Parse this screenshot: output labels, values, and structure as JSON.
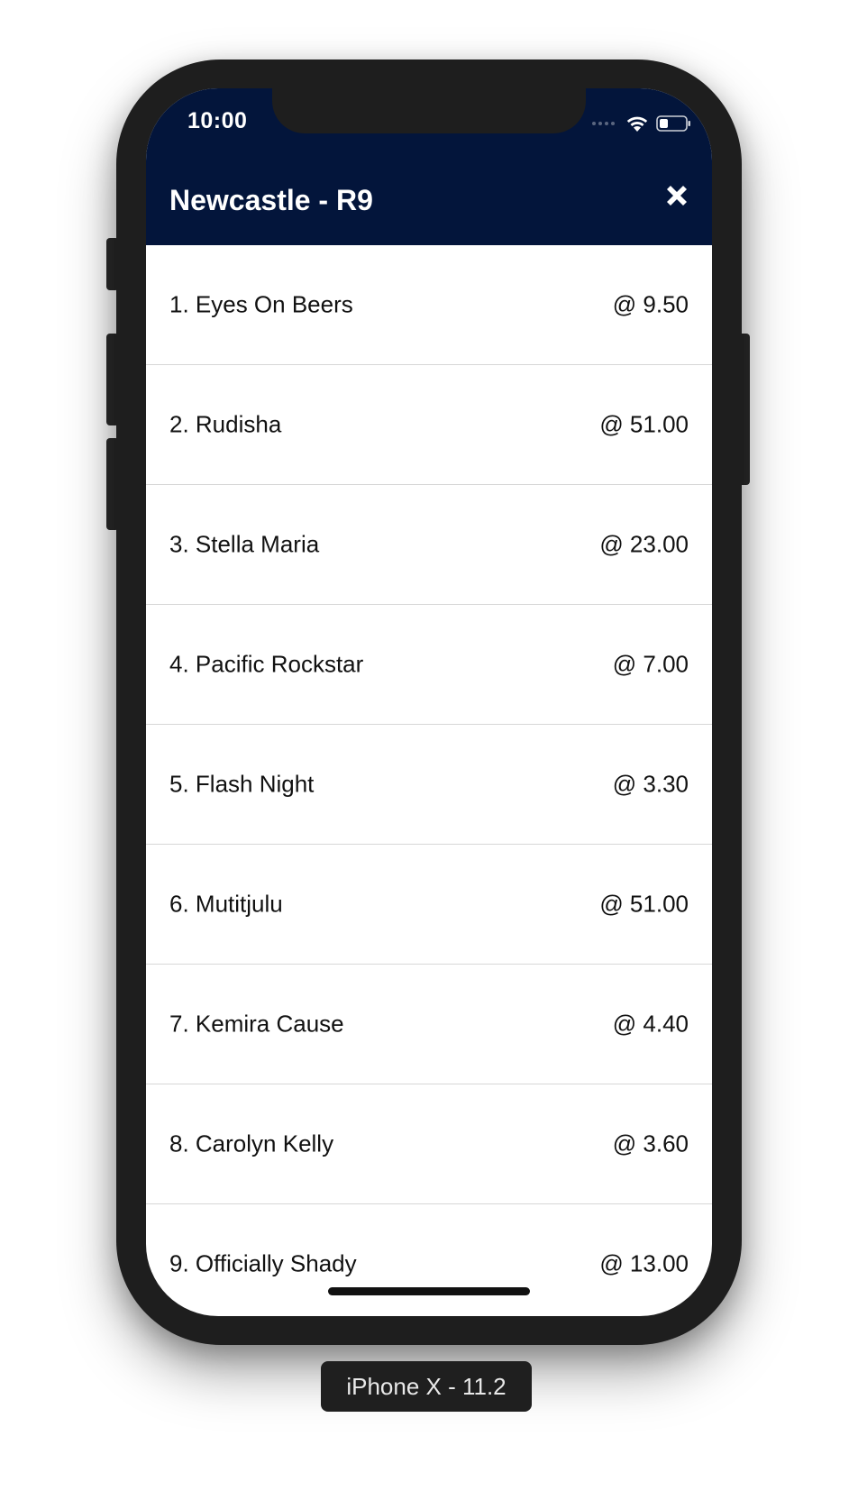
{
  "status_bar": {
    "time": "10:00"
  },
  "header": {
    "title": "Newcastle - R9",
    "close_icon": "close-icon",
    "background_color": "#03153b"
  },
  "runners": [
    {
      "name": "1. Eyes On Beers",
      "odds": "@ 9.50"
    },
    {
      "name": "2. Rudisha",
      "odds": "@ 51.00"
    },
    {
      "name": "3. Stella Maria",
      "odds": "@ 23.00"
    },
    {
      "name": "4. Pacific Rockstar",
      "odds": "@ 7.00"
    },
    {
      "name": "5. Flash Night",
      "odds": "@ 3.30"
    },
    {
      "name": "6. Mutitjulu",
      "odds": "@ 51.00"
    },
    {
      "name": "7. Kemira Cause",
      "odds": "@ 4.40"
    },
    {
      "name": "8. Carolyn Kelly",
      "odds": "@ 3.60"
    },
    {
      "name": "9. Officially Shady",
      "odds": "@ 13.00"
    }
  ],
  "device_label": "iPhone X - 11.2"
}
